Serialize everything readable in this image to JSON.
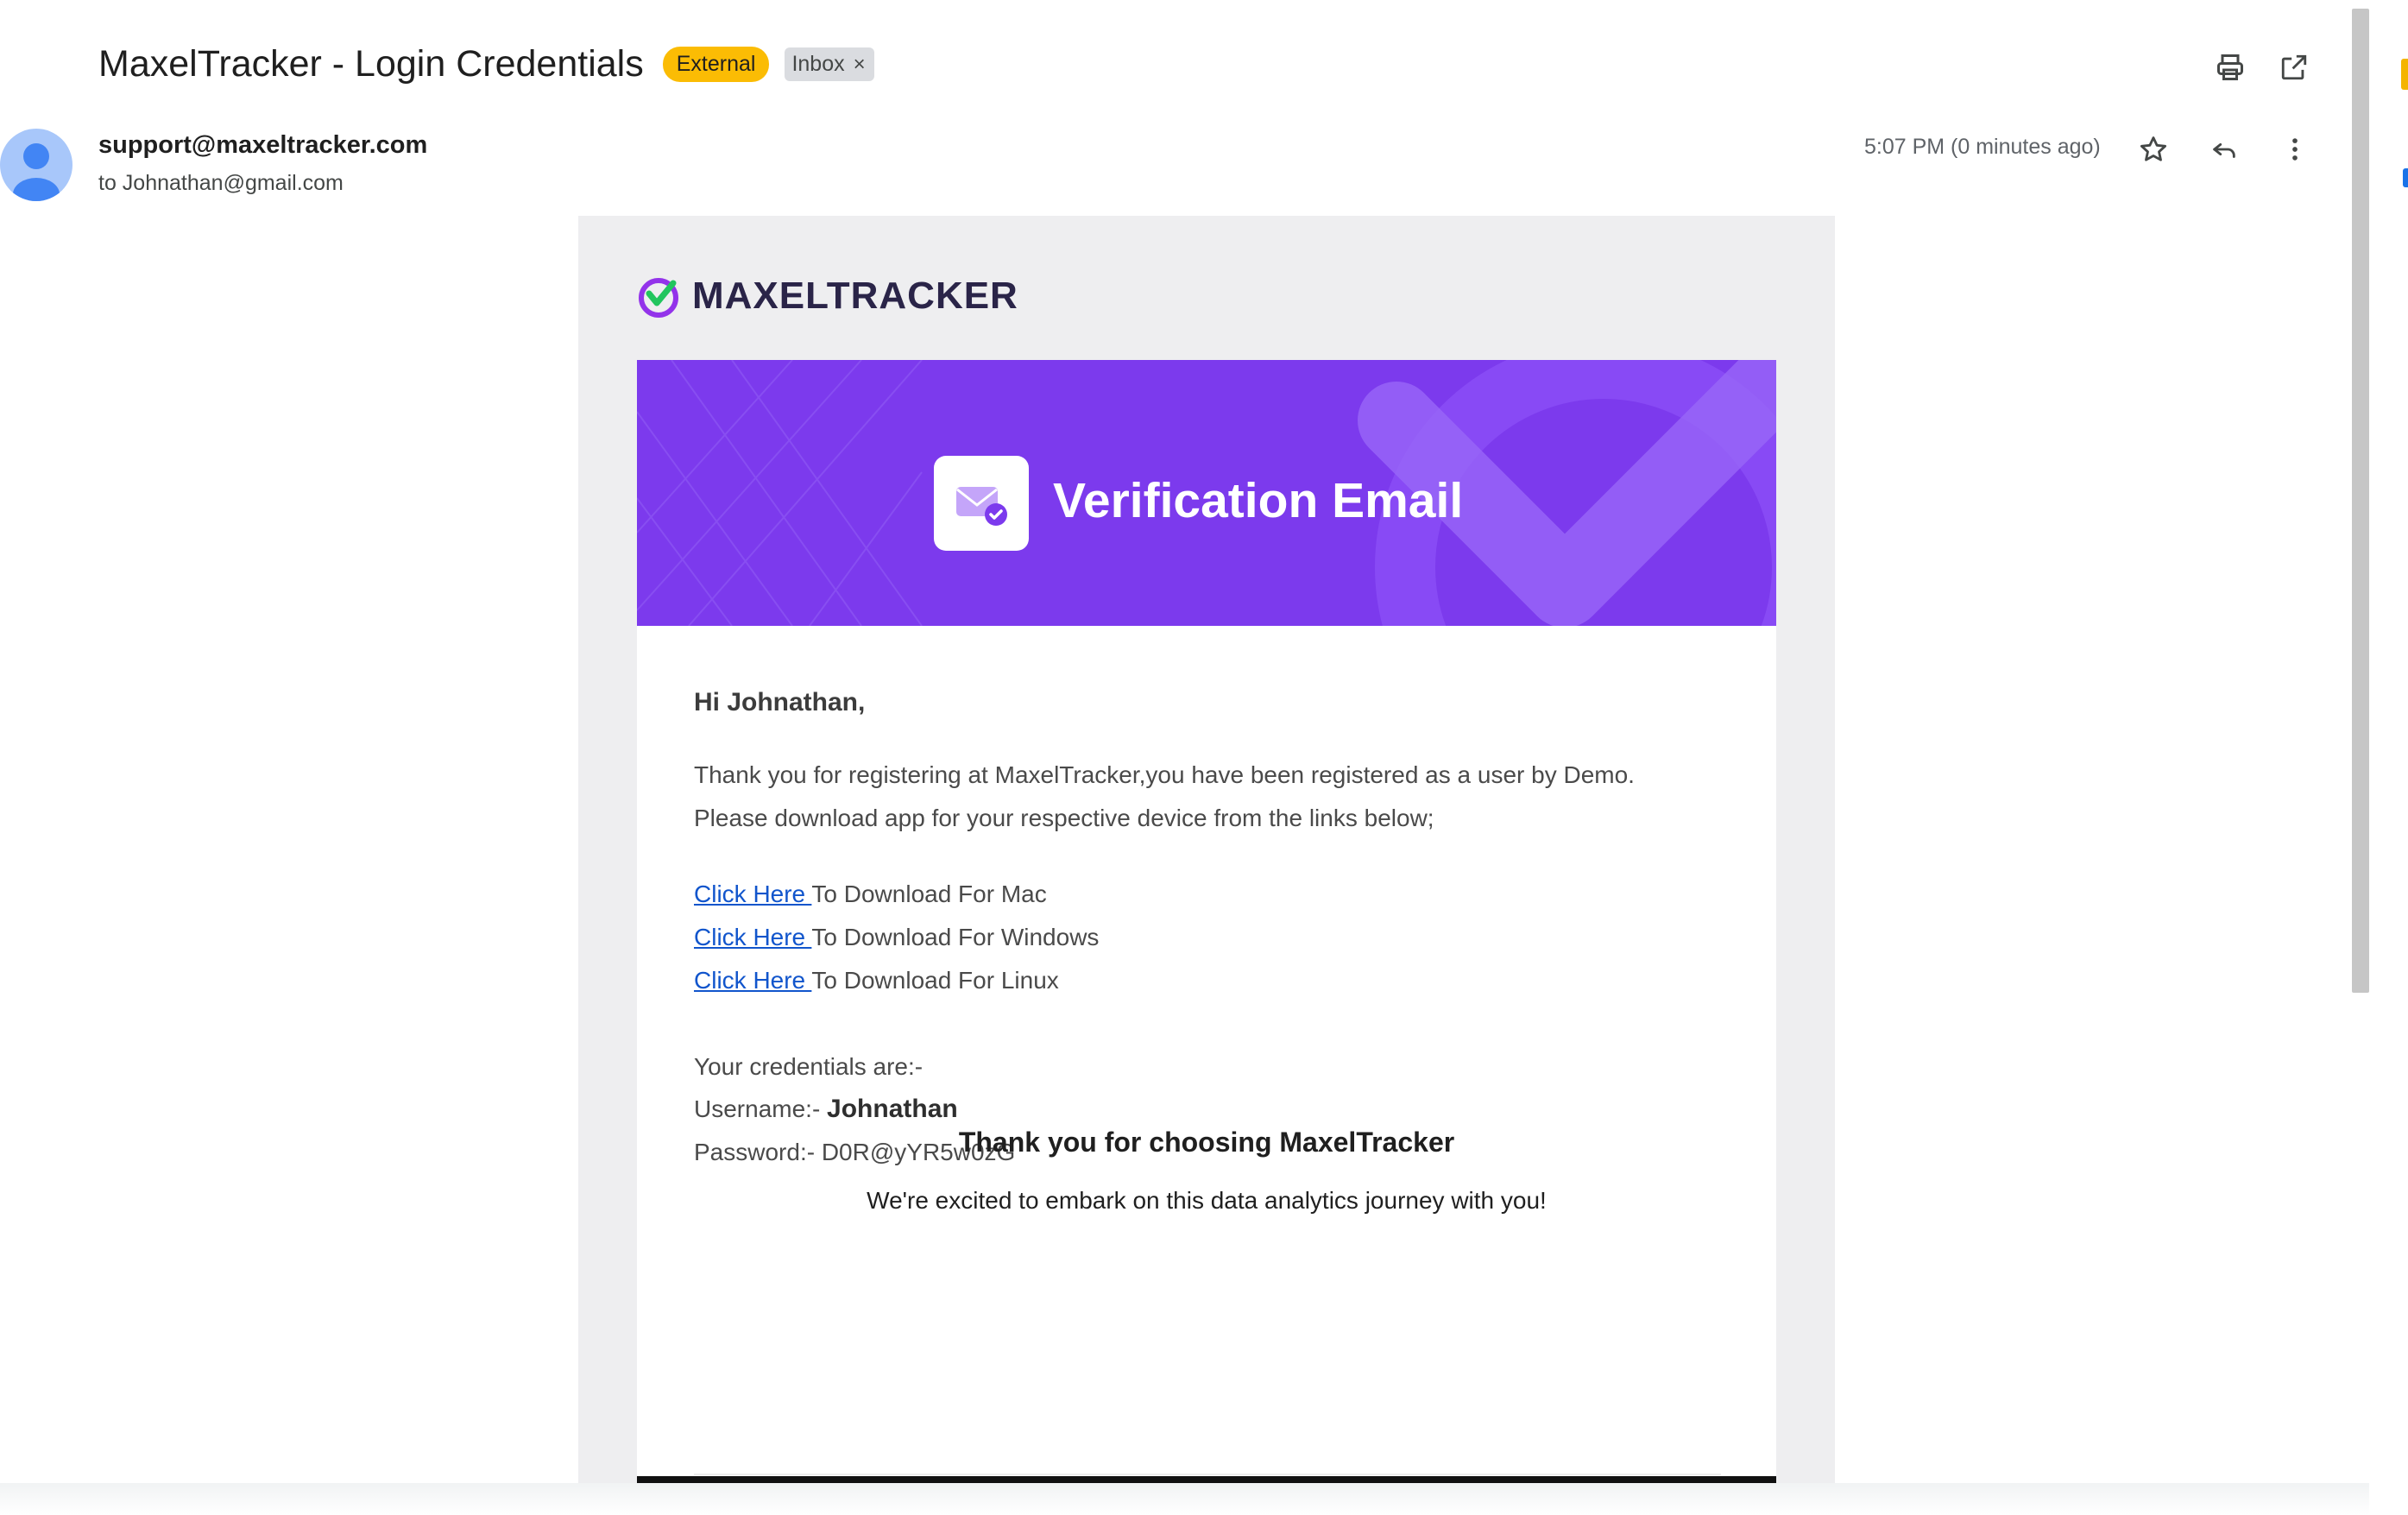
{
  "subject": {
    "title": "MaxelTracker - Login Credentials",
    "badge_external": "External",
    "badge_inbox": "Inbox",
    "badge_inbox_close": "×"
  },
  "header_icons": {
    "print": "print-icon",
    "open_new_window": "open-in-new-window-icon"
  },
  "sender": {
    "email": "support@maxeltracker.com",
    "to_line": "to Johnathan@gmail.com",
    "timestamp": "5:07 PM (0 minutes ago)",
    "icons": [
      "star-icon",
      "reply-icon",
      "more-vertical-icon"
    ]
  },
  "email": {
    "brand": "MAXELTRACKER",
    "banner_title": "Verification Email",
    "greeting": "Hi Johnathan,",
    "para_line1": "Thank you for registering at MaxelTracker,you have been registered as a user by Demo.",
    "para_line2": "Please download app for your respective device from the links below;",
    "downloads": [
      {
        "link": "Click Here ",
        "text": "To Download For Mac"
      },
      {
        "link": "Click Here ",
        "text": "To Download For Windows"
      },
      {
        "link": "Click Here ",
        "text": "To Download For Linux"
      }
    ],
    "credentials_intro": "Your credentials are:-",
    "username_label": "Username:- ",
    "username_value": "Johnathan",
    "password_label": "Password:- ",
    "password_value": "D0R@yYR5w0zG",
    "thanks_title": "Thank you for choosing MaxelTracker",
    "thanks_sub": "We're excited to embark on this data analytics journey with you!"
  },
  "colors": {
    "banner": "#7c3aed",
    "external_badge": "#fbbc04",
    "link": "#1155cc"
  }
}
